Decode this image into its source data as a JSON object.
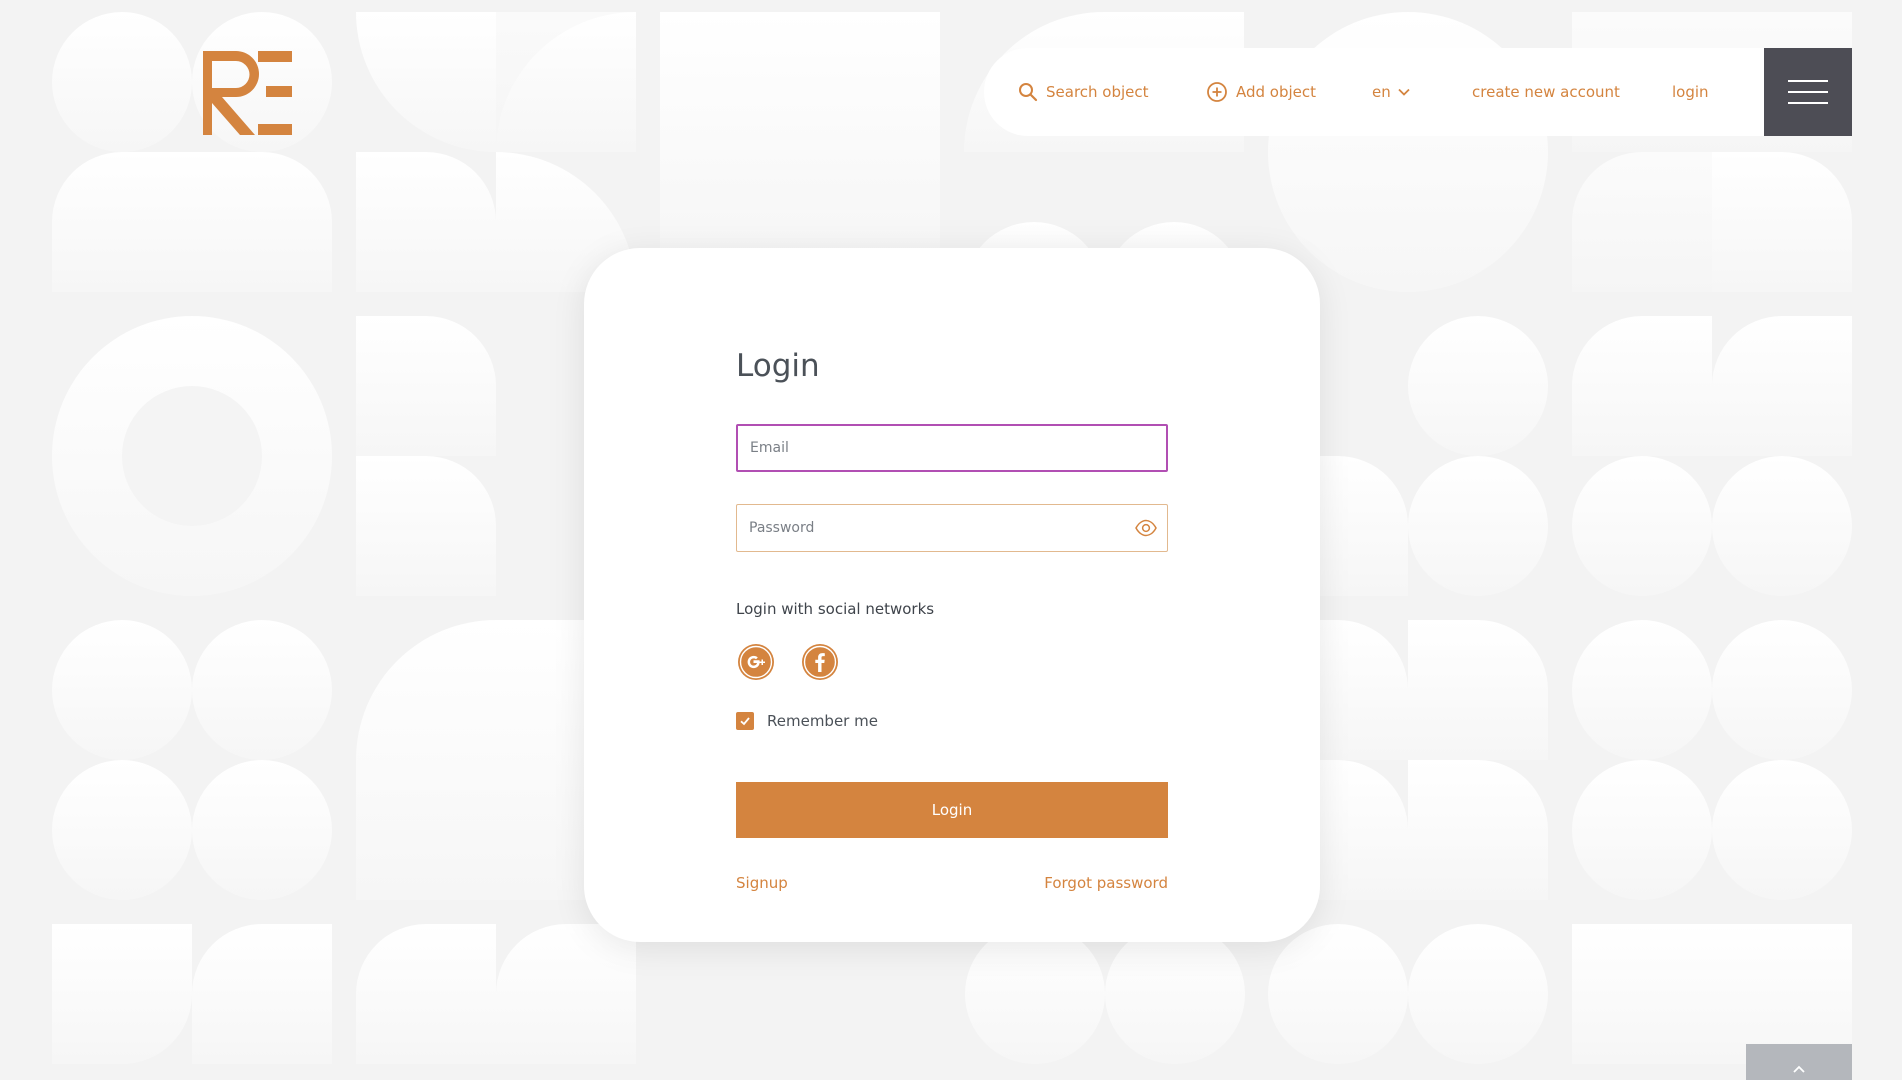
{
  "app": {
    "brand_color": "#d4843f",
    "dark_color": "#4d4d55"
  },
  "header": {
    "nav": [
      {
        "label": "Search object",
        "icon": "search-icon"
      },
      {
        "label": "Add object",
        "icon": "plus-circle-icon"
      },
      {
        "label": "en",
        "icon": "chevron-down-icon"
      },
      {
        "label": "create new account"
      },
      {
        "label": "login"
      }
    ],
    "menu_icon": "hamburger-menu-icon"
  },
  "form": {
    "title": "Login",
    "email_placeholder": "Email",
    "password_placeholder": "Password",
    "social_label": "Login with social networks",
    "social_buttons": [
      {
        "icon": "google-plus-icon"
      },
      {
        "icon": "facebook-icon"
      }
    ],
    "remember_label": "Remember me",
    "remember_checked": true,
    "submit_label": "Login",
    "signup_label": "Signup",
    "forgot_label": "Forgot password"
  },
  "scroll_top_icon": "chevron-up-icon"
}
